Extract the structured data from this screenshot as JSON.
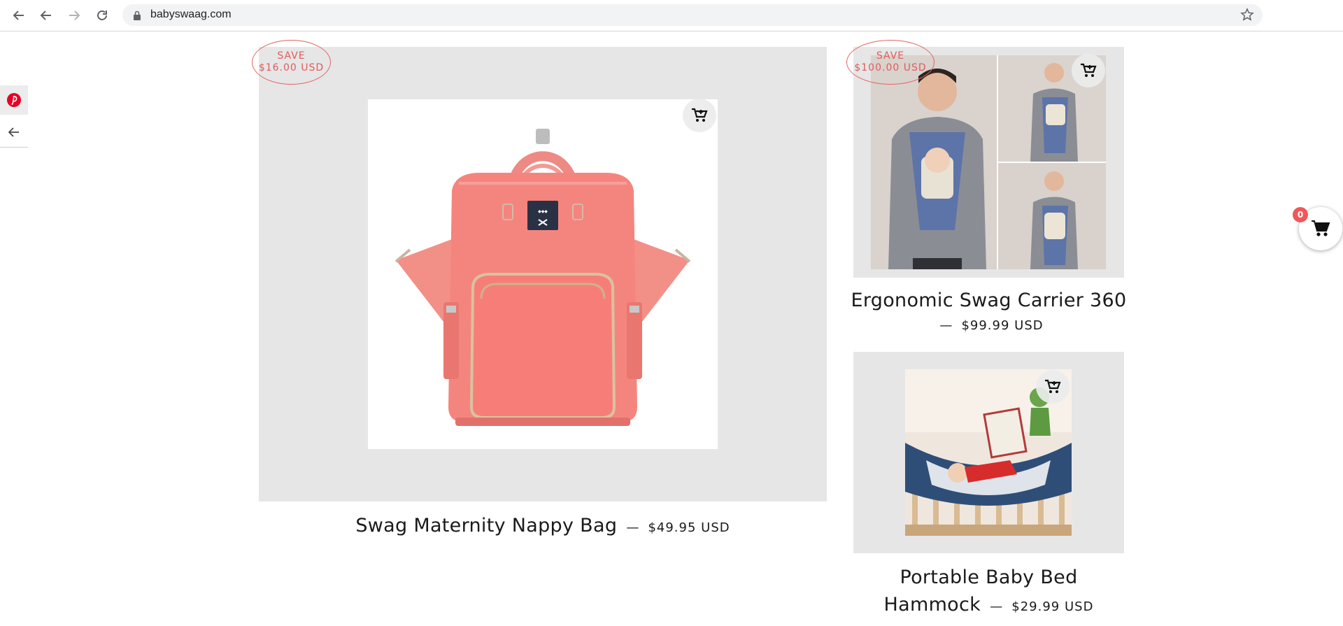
{
  "browser": {
    "url": "babyswaag.com"
  },
  "products": [
    {
      "save_line1": "SAVE",
      "save_line2": "$16.00 USD",
      "title": "Swag Maternity Nappy Bag",
      "dash": "—",
      "price": "$49.95 USD",
      "image": "pink-diaper-backpack"
    },
    {
      "save_line1": "SAVE",
      "save_line2": "$100.00 USD",
      "title": "Ergonomic Swag Carrier 360",
      "dash": "—",
      "price": "$99.99 USD",
      "image": "man-wearing-baby-carrier"
    },
    {
      "title_line1": "Portable Baby Bed",
      "title_line2": "Hammock",
      "dash": "—",
      "price": "$29.99 USD",
      "image": "baby-in-crib-hammock"
    }
  ],
  "cart": {
    "count": "0"
  },
  "colors": {
    "accent": "#e25b5b",
    "panel": "#e6e6e6",
    "pinterest": "#e60023"
  },
  "icons": {
    "back": "arrow-left-icon",
    "forward": "arrow-right-icon",
    "reload": "reload-icon",
    "lock": "lock-icon",
    "bookmark": "star-icon",
    "pinterest": "pinterest-icon",
    "quick_add": "cart-plus-icon",
    "cart": "cart-icon"
  }
}
